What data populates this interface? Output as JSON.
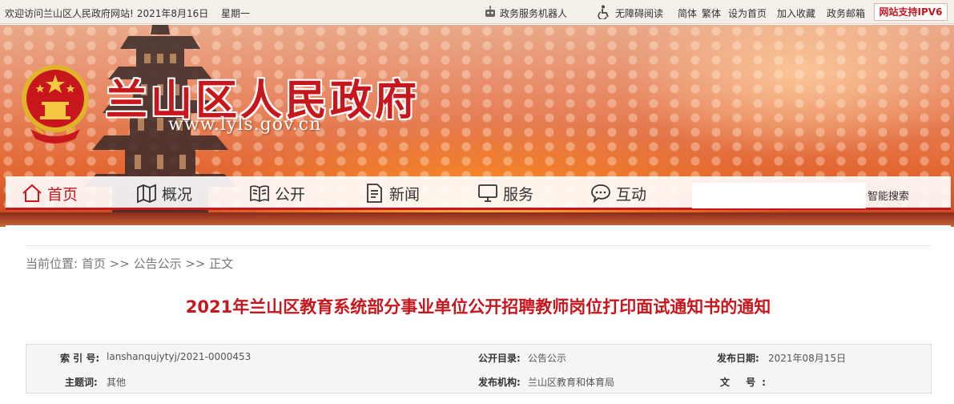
{
  "topbar": {
    "welcome": "欢迎访问兰山区人民政府网站!",
    "date": "2021年8月16日",
    "weekday": "星期一",
    "robot": "政务服务机器人",
    "accessibility": "无障碍阅读",
    "simplified": "简体",
    "traditional": "繁体",
    "set_home": "设为首页",
    "add_fav": "加入收藏",
    "mail": "政务邮箱",
    "ipv6": "网站支持IPV6"
  },
  "banner": {
    "title": "兰山区人民政府",
    "url": "www.lyls.gov.cn"
  },
  "nav": {
    "items": [
      {
        "label": "首页",
        "icon": "home-icon"
      },
      {
        "label": "概况",
        "icon": "map-icon"
      },
      {
        "label": "公开",
        "icon": "book-icon"
      },
      {
        "label": "新闻",
        "icon": "document-icon"
      },
      {
        "label": "服务",
        "icon": "monitor-icon"
      },
      {
        "label": "互动",
        "icon": "chat-icon"
      }
    ],
    "search_placeholder": "",
    "search_button": "智能搜索"
  },
  "breadcrumb": {
    "prefix": "当前位置:",
    "home": "首页",
    "sep1": ">>",
    "section": "公告公示",
    "sep2": ">>",
    "current": "正文"
  },
  "article": {
    "title": "2021年兰山区教育系统部分事业单位公开招聘教师岗位打印面试通知书的通知"
  },
  "meta": {
    "index_label": "索 引 号:",
    "index_value": "lanshanqujytyj/2021-0000453",
    "catalog_label": "公开目录:",
    "catalog_value": "公告公示",
    "date_label": "发布日期:",
    "date_value": "2021年08月15日",
    "topic_label": "主题词:",
    "topic_value": "其他",
    "org_label": "发布机构:",
    "org_value": "兰山区教育和体育局",
    "docno_label": "文 号:",
    "docno_value": ""
  },
  "colors": {
    "brand_red": "#c8161d"
  }
}
